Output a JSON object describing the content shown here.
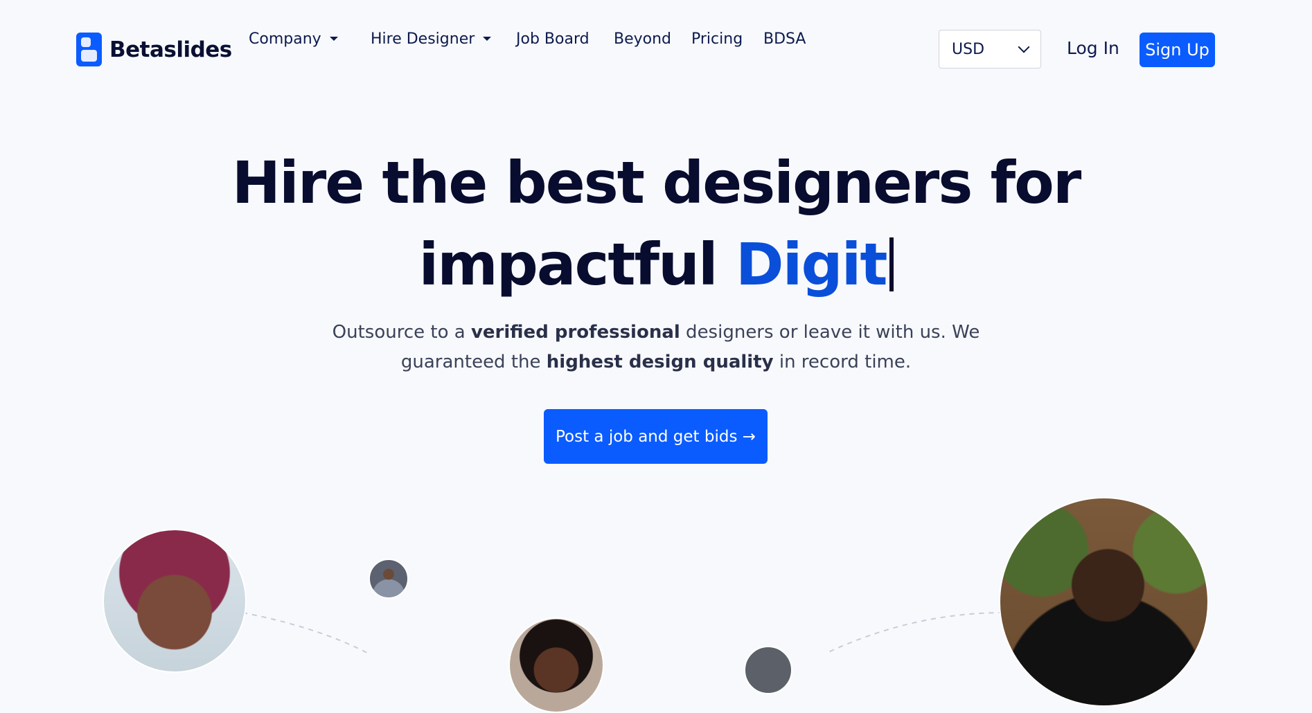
{
  "brand": {
    "name": "Betaslides",
    "accent_color": "#0a5cff",
    "logo_icon": "betaslides-logo-icon"
  },
  "nav": {
    "items": [
      {
        "label": "Company",
        "has_dropdown": true
      },
      {
        "label": "Hire Designer",
        "has_dropdown": true
      },
      {
        "label": "Job Board",
        "has_dropdown": false
      },
      {
        "label": "Beyond",
        "has_dropdown": false
      },
      {
        "label": "Pricing",
        "has_dropdown": false
      },
      {
        "label": "BDSA",
        "has_dropdown": false
      }
    ],
    "currency": {
      "selected": "USD"
    },
    "login_label": "Log In",
    "signup_label": "Sign Up"
  },
  "hero": {
    "title_line1": "Hire the best designers for",
    "title_line2_prefix": "impactful",
    "title_line2_accent": "Digit",
    "title_accent_color": "#0a4fd9",
    "subtitle": {
      "part1": "Outsource to a ",
      "bold1": "verified professional",
      "part2": " designers or leave it with us. We",
      "part3": "guaranteed the ",
      "bold2": "highest design quality",
      "part4": " in record time."
    },
    "cta_label": "Post a job and get bids →"
  }
}
